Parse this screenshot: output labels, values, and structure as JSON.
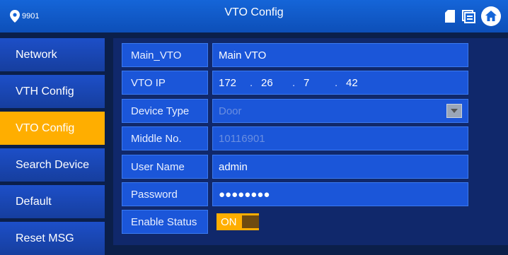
{
  "header": {
    "device_id": "9901",
    "title": "VTO Config",
    "icons": [
      "map-pin-icon",
      "sd-card-icon",
      "screen-icon",
      "home-icon"
    ]
  },
  "sidebar": {
    "active": "VTO Config",
    "items": [
      {
        "label": "Network"
      },
      {
        "label": "VTH Config"
      },
      {
        "label": "VTO Config"
      },
      {
        "label": "Search Device"
      },
      {
        "label": "Default"
      },
      {
        "label": "Reset MSG"
      }
    ]
  },
  "form": {
    "main_vto": {
      "label": "Main_VTO",
      "value": "Main VTO"
    },
    "vto_ip": {
      "label": "VTO IP",
      "octets": [
        "172",
        "26",
        "7",
        "42"
      ],
      "separator": "."
    },
    "device_type": {
      "label": "Device Type",
      "value": "Door"
    },
    "middle_no": {
      "label": "Middle No.",
      "value": "10116901"
    },
    "user_name": {
      "label": "User Name",
      "value": "admin"
    },
    "password": {
      "label": "Password",
      "value": "●●●●●●●●"
    },
    "enable_status": {
      "label": "Enable Status",
      "value": "ON"
    }
  },
  "colors": {
    "title_bar": "#1565d8",
    "accent": "#ffae00",
    "field": "#1b56d9",
    "background": "#0b1f4a"
  }
}
